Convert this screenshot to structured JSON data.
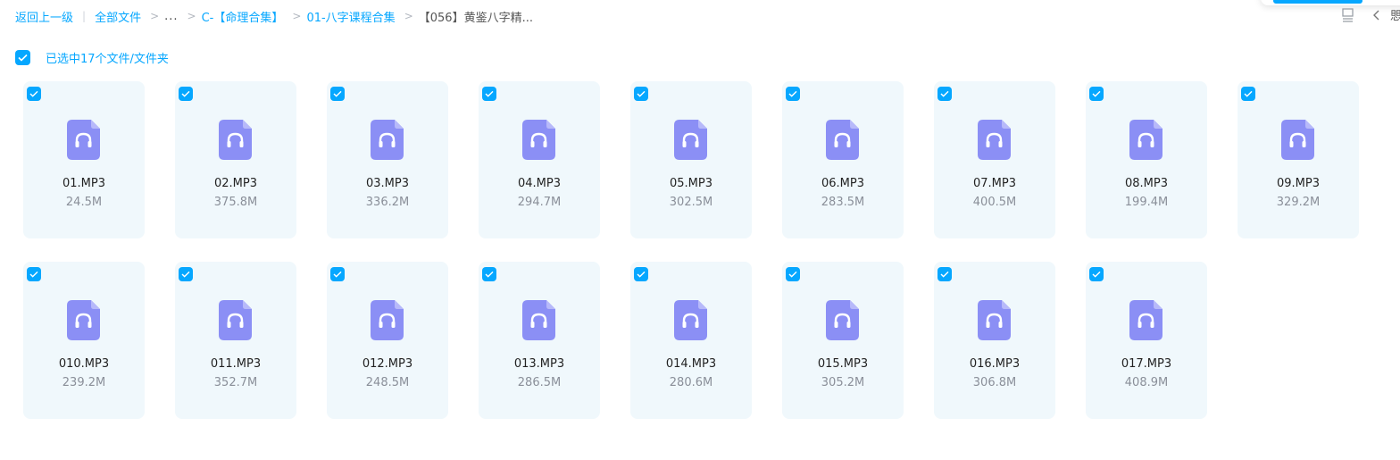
{
  "breadcrumb": {
    "back": "返回上一级",
    "all_files": "全部文件",
    "more": "...",
    "level1": "C-【命理合集】",
    "level2": "01-八字课程合集",
    "current": "【056】黄鉴八字精..."
  },
  "toolbar": {
    "partial_label": "愳"
  },
  "selection": {
    "label": "已选中17个文件/文件夹",
    "checked": true
  },
  "theme": {
    "accent": "#06a7ff",
    "card_bg": "#f0f8fc",
    "file_icon": "#8b8ff5"
  },
  "files": [
    {
      "name": "01.MP3",
      "size": "24.5M",
      "icon": "audio-file-icon",
      "checked": true
    },
    {
      "name": "02.MP3",
      "size": "375.8M",
      "icon": "audio-file-icon",
      "checked": true
    },
    {
      "name": "03.MP3",
      "size": "336.2M",
      "icon": "audio-file-icon",
      "checked": true
    },
    {
      "name": "04.MP3",
      "size": "294.7M",
      "icon": "audio-file-icon",
      "checked": true
    },
    {
      "name": "05.MP3",
      "size": "302.5M",
      "icon": "audio-file-icon",
      "checked": true
    },
    {
      "name": "06.MP3",
      "size": "283.5M",
      "icon": "audio-file-icon",
      "checked": true
    },
    {
      "name": "07.MP3",
      "size": "400.5M",
      "icon": "audio-file-icon",
      "checked": true
    },
    {
      "name": "08.MP3",
      "size": "199.4M",
      "icon": "audio-file-icon",
      "checked": true
    },
    {
      "name": "09.MP3",
      "size": "329.2M",
      "icon": "audio-file-icon",
      "checked": true
    },
    {
      "name": "010.MP3",
      "size": "239.2M",
      "icon": "audio-file-icon",
      "checked": true
    },
    {
      "name": "011.MP3",
      "size": "352.7M",
      "icon": "audio-file-icon",
      "checked": true
    },
    {
      "name": "012.MP3",
      "size": "248.5M",
      "icon": "audio-file-icon",
      "checked": true
    },
    {
      "name": "013.MP3",
      "size": "286.5M",
      "icon": "audio-file-icon",
      "checked": true
    },
    {
      "name": "014.MP3",
      "size": "280.6M",
      "icon": "audio-file-icon",
      "checked": true
    },
    {
      "name": "015.MP3",
      "size": "305.2M",
      "icon": "audio-file-icon",
      "checked": true
    },
    {
      "name": "016.MP3",
      "size": "306.8M",
      "icon": "audio-file-icon",
      "checked": true
    },
    {
      "name": "017.MP3",
      "size": "408.9M",
      "icon": "audio-file-icon",
      "checked": true
    }
  ]
}
